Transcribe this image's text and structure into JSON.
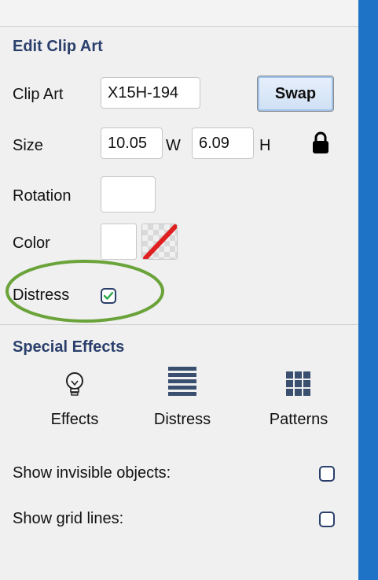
{
  "edit_clip_art": {
    "title": "Edit Clip Art",
    "clip_art_label": "Clip Art",
    "clip_art_value": "X15H-194",
    "swap_label": "Swap",
    "size_label": "Size",
    "width_value": "10.05",
    "width_unit": "W",
    "height_value": "6.09",
    "height_unit": "H",
    "rotation_label": "Rotation",
    "rotation_value": "",
    "color_label": "Color",
    "distress_label": "Distress",
    "distress_checked": true,
    "highlight_color": "#6aa33a"
  },
  "special_effects": {
    "title": "Special Effects",
    "items": [
      {
        "label": "Effects",
        "icon": "lightbulb-icon"
      },
      {
        "label": "Distress",
        "icon": "lines-icon"
      },
      {
        "label": "Patterns",
        "icon": "grid-icon"
      }
    ]
  },
  "options": {
    "show_invisible_label": "Show invisible objects:",
    "show_grid_label": "Show grid lines:"
  },
  "colors": {
    "sidebar_blue": "#1f73c6",
    "title_navy": "#2a3f6b",
    "check_green": "#2aa84a",
    "none_slash_red": "#e02020"
  }
}
